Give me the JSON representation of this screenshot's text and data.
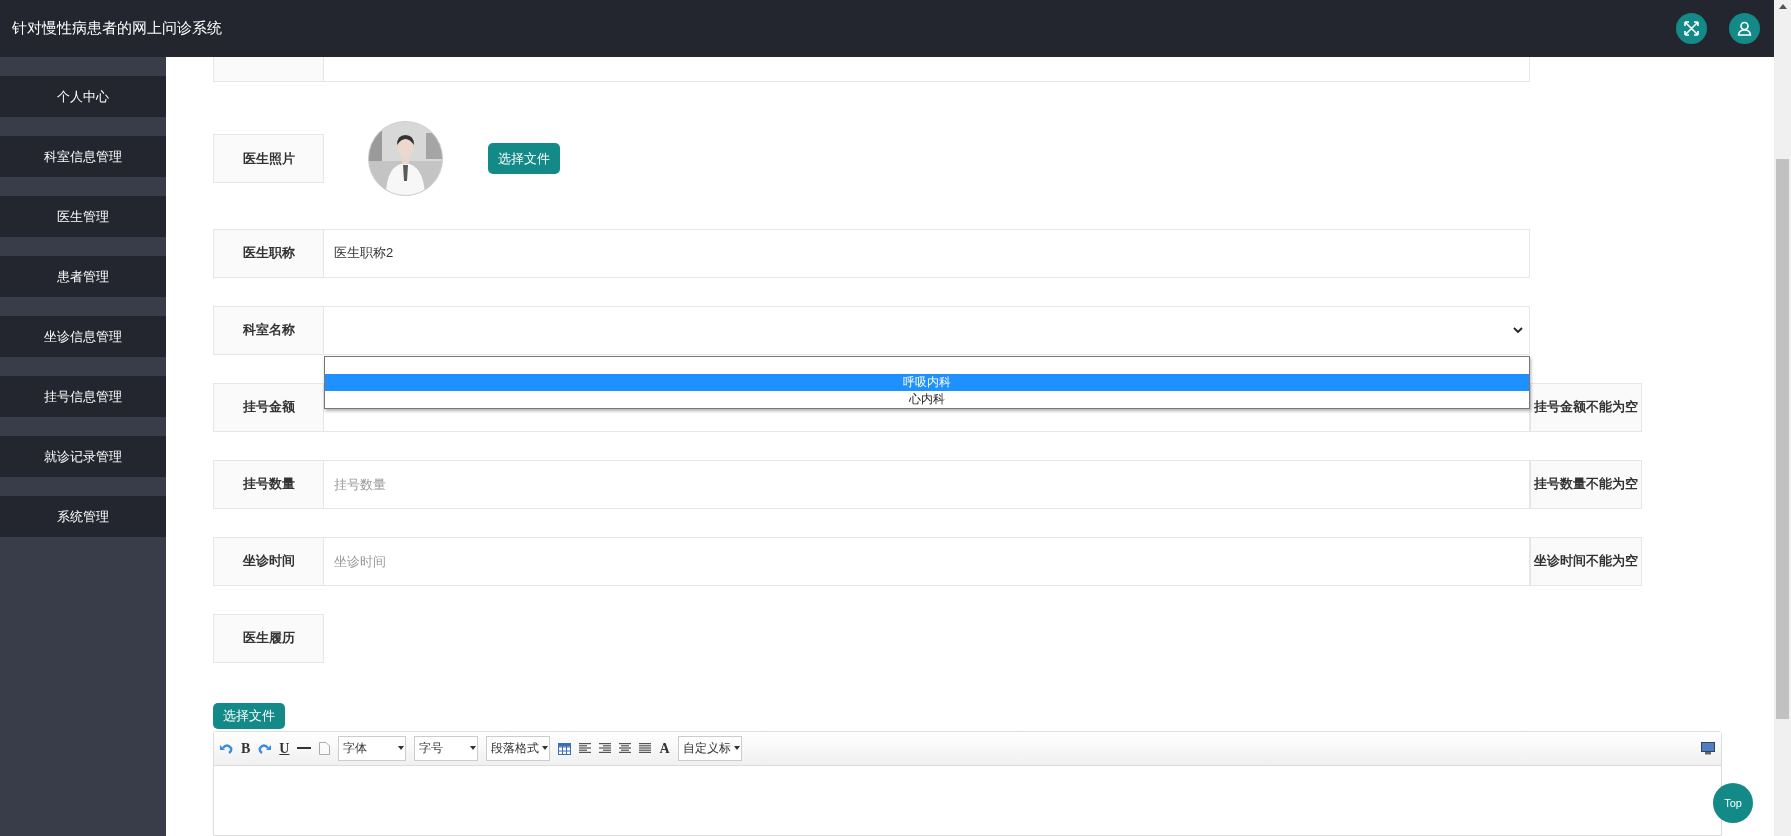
{
  "header": {
    "title": "针对慢性病患者的网上问诊系统"
  },
  "sidebar": {
    "items": [
      {
        "label": "个人中心"
      },
      {
        "label": "科室信息管理"
      },
      {
        "label": "医生管理"
      },
      {
        "label": "患者管理"
      },
      {
        "label": "坐诊信息管理"
      },
      {
        "label": "挂号信息管理"
      },
      {
        "label": "就诊记录管理"
      },
      {
        "label": "系统管理"
      }
    ]
  },
  "form": {
    "rows": [
      {
        "kind": "clipped"
      },
      {
        "label": "医生照片",
        "button": "选择文件"
      },
      {
        "kind": "text",
        "label": "医生职称",
        "value": "医生职称2"
      },
      {
        "kind": "select",
        "label": "科室名称",
        "options": [
          {
            "label": "呼吸内科",
            "selected": true
          },
          {
            "label": "心内科",
            "selected": false
          }
        ]
      },
      {
        "kind": "text",
        "label": "挂号金额",
        "error": "挂号金额不能为空"
      },
      {
        "kind": "text",
        "label": "挂号数量",
        "placeholder": "挂号数量",
        "error": "挂号数量不能为空"
      },
      {
        "kind": "text",
        "label": "坐诊时间",
        "placeholder": "坐诊时间",
        "error": "坐诊时间不能为空"
      },
      {
        "kind": "label",
        "label": "医生履历"
      }
    ]
  },
  "editor": {
    "upload_button": "选择文件",
    "bold": "B",
    "underline": "U",
    "font_color": "A",
    "dropdowns": [
      "字体",
      "字号",
      "段落格式",
      "自定义标"
    ]
  },
  "top_button": "Top"
}
